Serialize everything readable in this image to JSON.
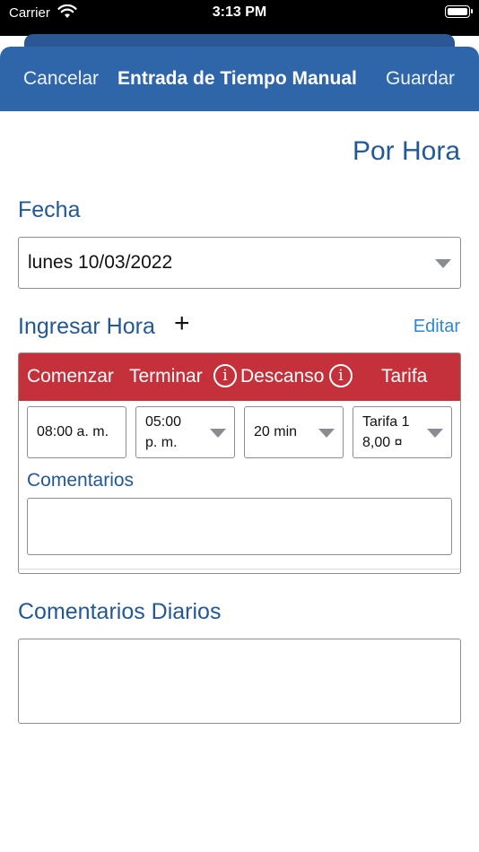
{
  "status": {
    "carrier": "Carrier",
    "time": "3:13 PM"
  },
  "nav": {
    "cancel": "Cancelar",
    "title": "Entrada de Tiempo Manual",
    "save": "Guardar"
  },
  "mode": "Por Hora",
  "date": {
    "label": "Fecha",
    "value": "lunes 10/03/2022"
  },
  "entry": {
    "label": "Ingresar Hora",
    "add_glyph": "+",
    "edit": "Editar",
    "headers": {
      "start": "Comenzar",
      "end": "Terminar",
      "break": "Descanso",
      "rate": "Tarifa",
      "info_glyph": "i"
    },
    "row": {
      "start": "08:00 a. m.",
      "end_line1": "05:00",
      "end_line2": "p. m.",
      "break": "20 min",
      "rate_line1": "Tarifa 1",
      "rate_line2": "8,00 ¤"
    },
    "comments_label": "Comentarios",
    "comments_value": ""
  },
  "daily": {
    "label": "Comentarios Diarios",
    "value": ""
  },
  "colors": {
    "nav": "#2f65a9",
    "header_red": "#c4313a",
    "label_blue": "#235896",
    "link_blue": "#2f86d8"
  }
}
